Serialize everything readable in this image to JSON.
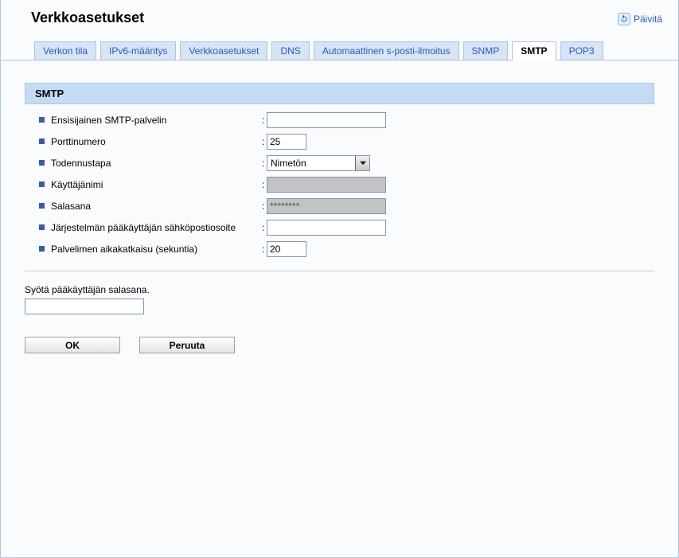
{
  "header": {
    "title": "Verkkoasetukset",
    "refresh_label": "Päivitä"
  },
  "tabs": [
    {
      "label": "Verkon tila"
    },
    {
      "label": "IPv6-määritys"
    },
    {
      "label": "Verkkoasetukset"
    },
    {
      "label": "DNS"
    },
    {
      "label": "Automaattinen s-posti-ilmoitus"
    },
    {
      "label": "SNMP"
    },
    {
      "label": "SMTP"
    },
    {
      "label": "POP3"
    }
  ],
  "section": {
    "title": "SMTP"
  },
  "form": {
    "primary_server": {
      "label": "Ensisijainen SMTP-palvelin",
      "value": ""
    },
    "port": {
      "label": "Porttinumero",
      "value": "25"
    },
    "auth": {
      "label": "Todennustapa",
      "selected": "Nimetön"
    },
    "username": {
      "label": "Käyttäjänimi",
      "value": ""
    },
    "password": {
      "label": "Salasana",
      "value": "********"
    },
    "admin_email": {
      "label": "Järjestelmän pääkäyttäjän sähköpostiosoite",
      "value": ""
    },
    "timeout": {
      "label": "Palvelimen aikakatkaisu (sekuntia)",
      "value": "20"
    }
  },
  "admin_pw": {
    "prompt": "Syötä pääkäyttäjän salasana.",
    "value": ""
  },
  "buttons": {
    "ok": "OK",
    "cancel": "Peruuta"
  }
}
